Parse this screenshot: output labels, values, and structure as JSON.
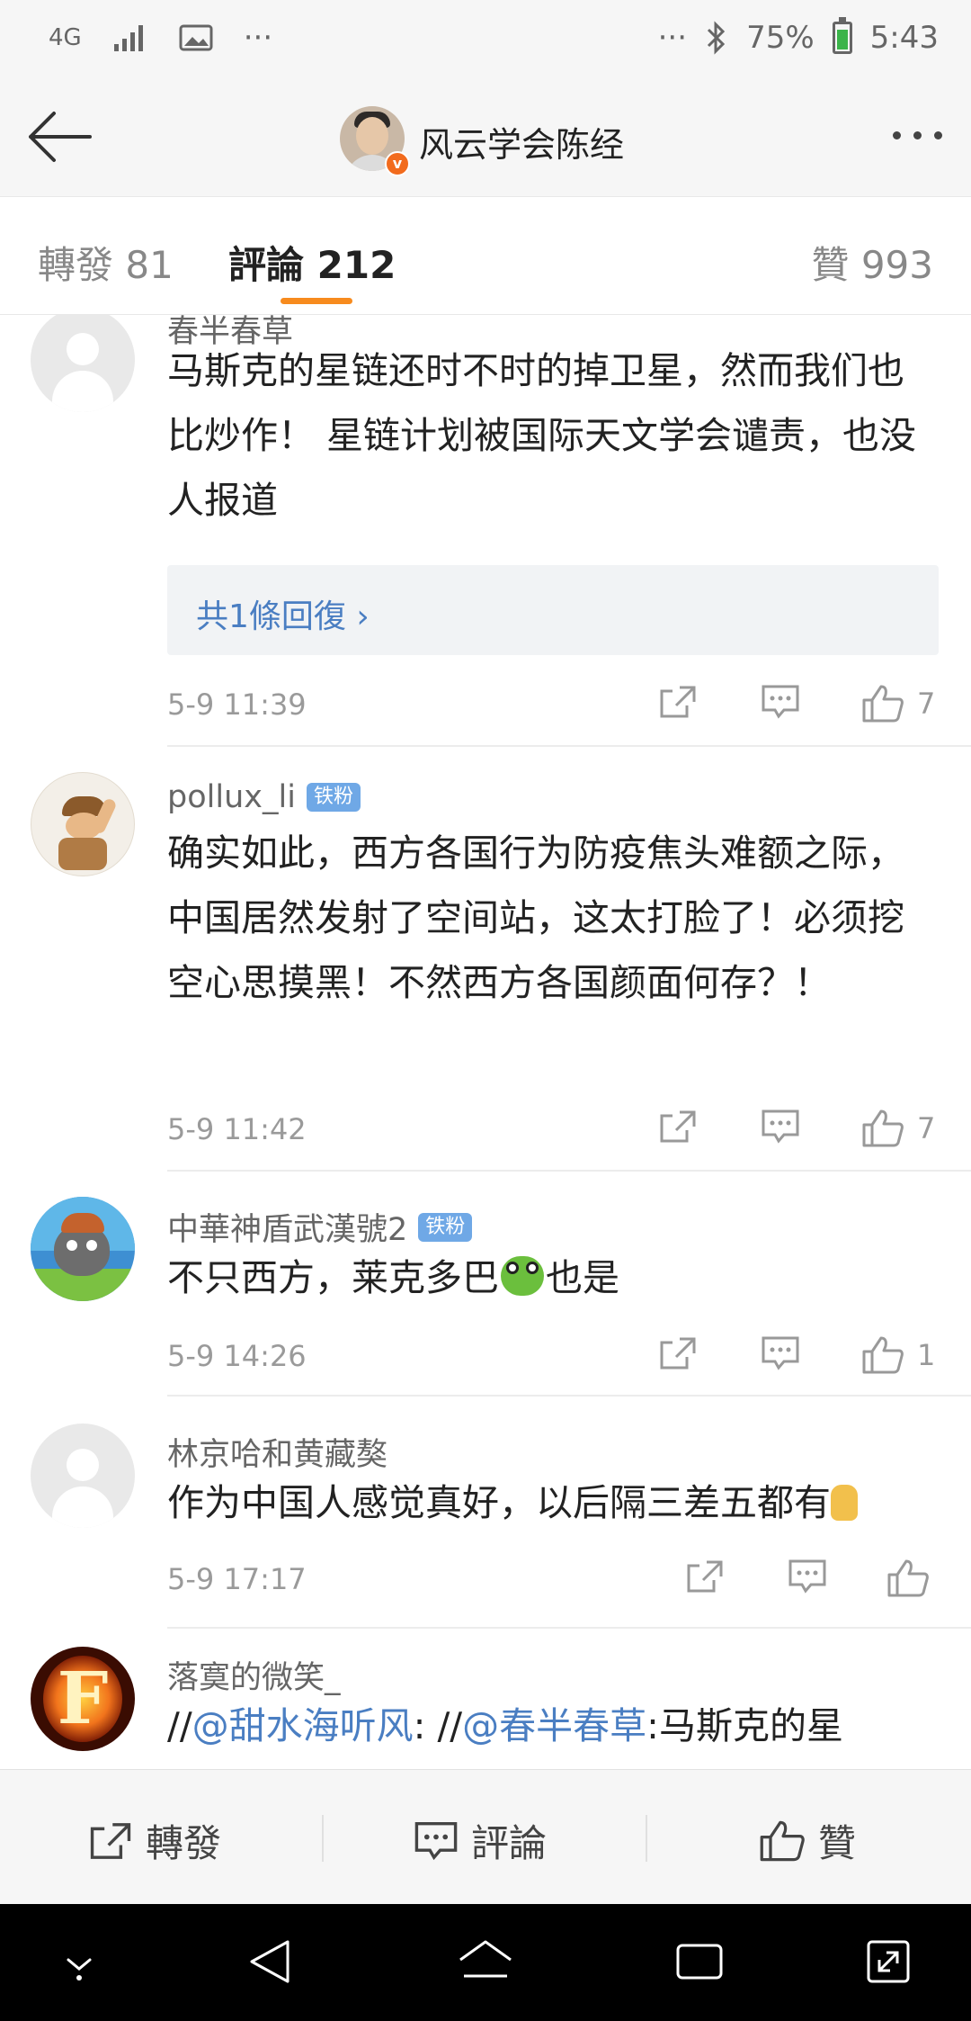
{
  "status_bar": {
    "network": "4G",
    "more": "···",
    "battery_text": "75%",
    "battery_level": 0.75,
    "time": "5:43"
  },
  "header": {
    "title": "风云学会陈经",
    "verified_mark": "v"
  },
  "tabs": {
    "forward": "轉發 81",
    "comments": "評論 212",
    "likes": "贊 993",
    "active": "comments"
  },
  "comments": [
    {
      "user": "春半春草",
      "badge": "",
      "text": "马斯克的星链还时不时的掉卫星，然而我们也比炒作！ 星链计划被国际天文学会谴责，也没人报道",
      "reply_summary": "共1條回復 ›",
      "time": "5-9 11:39",
      "likes": "7"
    },
    {
      "user": "pollux_li",
      "badge": "铁粉",
      "text": "确实如此，西方各国行为防疫焦头难额之际，中国居然发射了空间站，这太打脸了！必须挖空心思摸黑！不然西方各国颜面何存？！",
      "time": "5-9 11:42",
      "likes": "7"
    },
    {
      "user": "中華神盾武漢號2",
      "badge": "铁粉",
      "text_before": "不只西方，莱克多巴",
      "text_after": "也是",
      "time": "5-9 14:26",
      "likes": "1"
    },
    {
      "user": "林京哈和黄藏獒",
      "badge": "",
      "text": "作为中国人感觉真好，以后隔三差五都有",
      "time": "5-9 17:17",
      "likes": ""
    },
    {
      "user": "落寞的微笑_",
      "badge": "",
      "text_parts": [
        "//",
        "@甜水海听风",
        ": //",
        "@春半春草",
        ":马斯克的星"
      ],
      "avatar_letter": "F"
    }
  ],
  "bottom_bar": {
    "forward": "轉發",
    "comment": "評論",
    "like": "贊"
  },
  "colors": {
    "accent": "#f78b1e",
    "link": "#4a7ec2",
    "badge": "#6fa8e6",
    "verified": "#f26b1d"
  },
  "icons": [
    "back-arrow-icon",
    "more-icon",
    "share-icon",
    "comment-icon",
    "like-icon",
    "bluetooth-icon",
    "signal-icon",
    "gallery-icon"
  ]
}
